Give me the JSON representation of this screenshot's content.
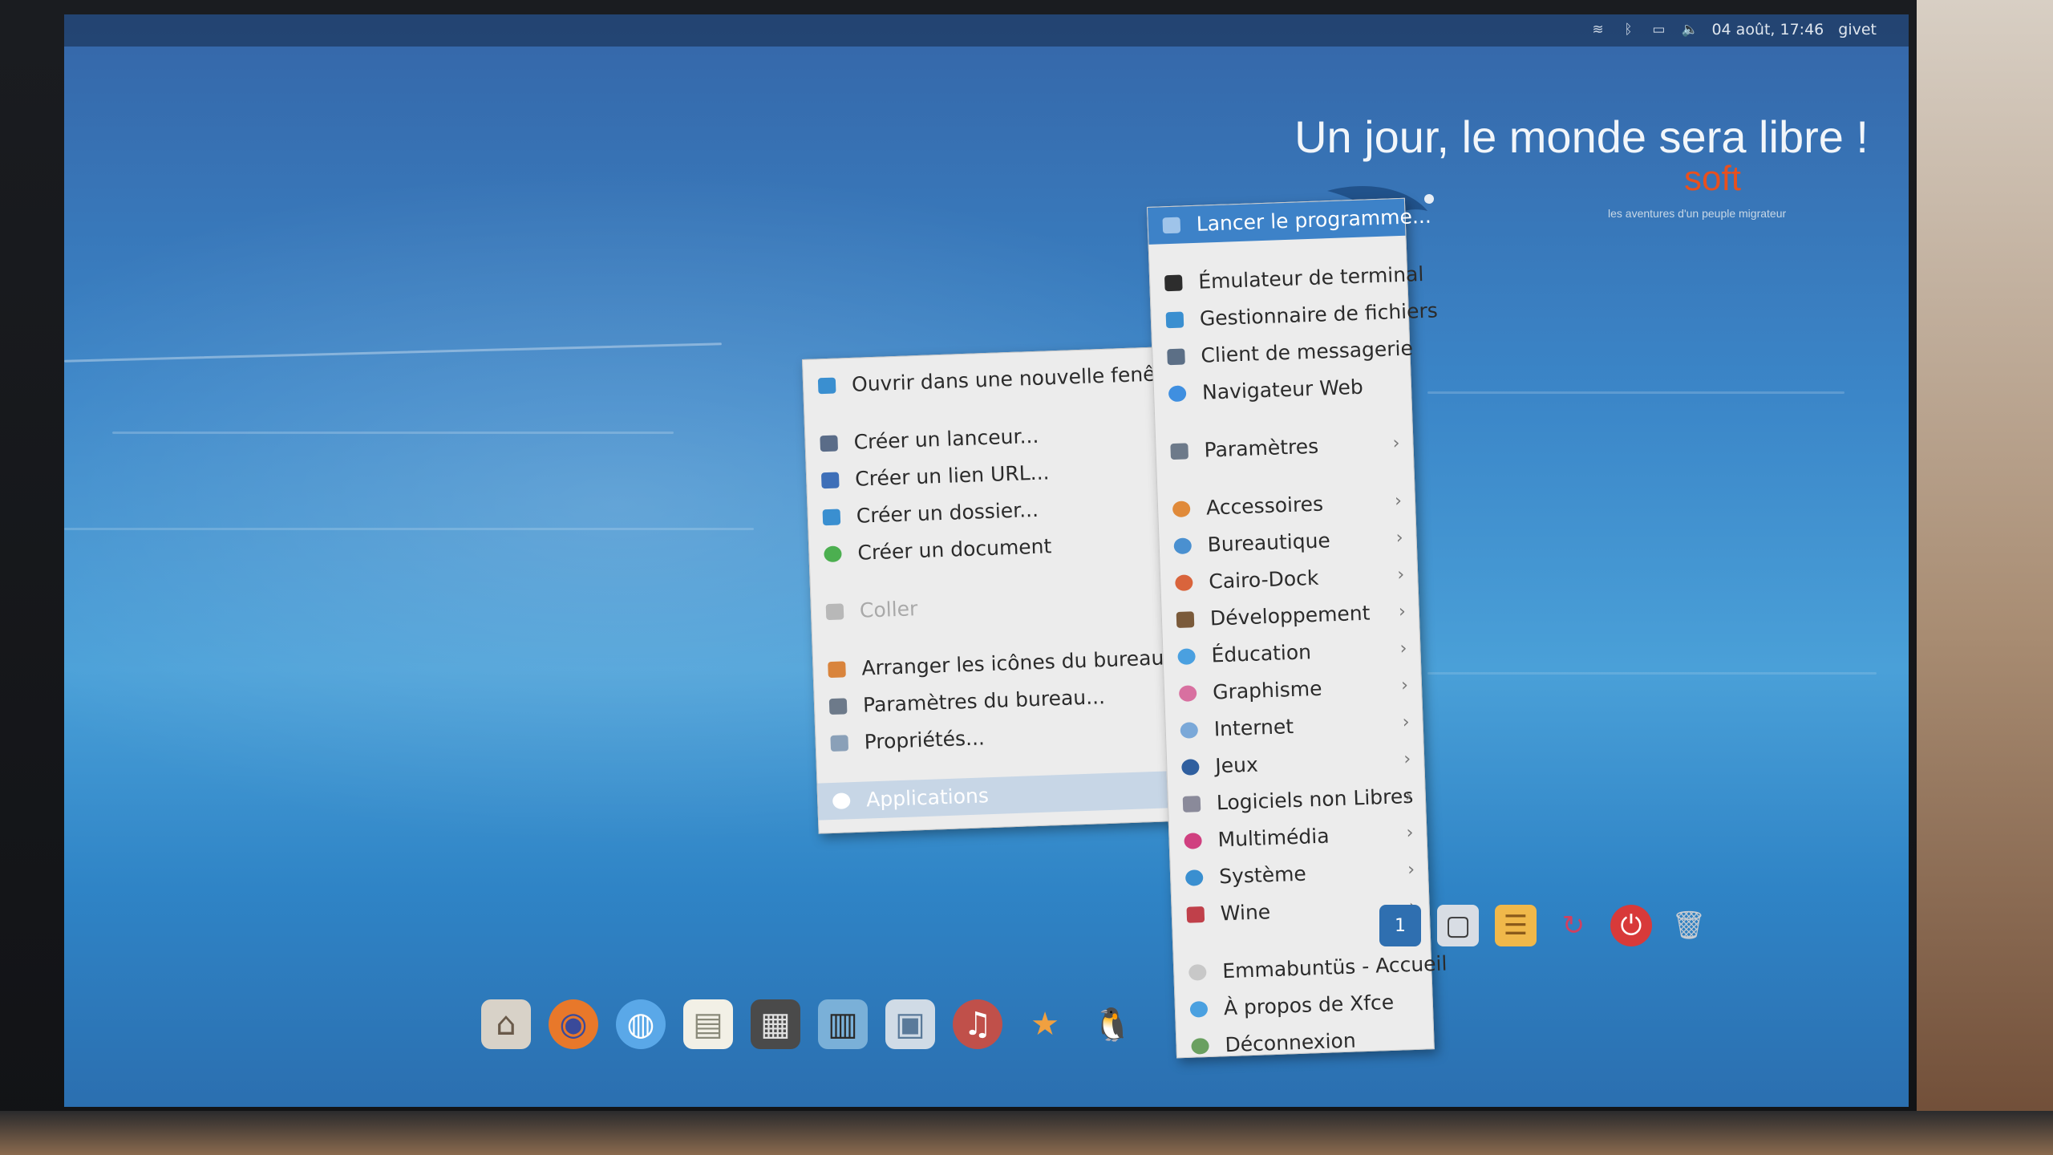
{
  "topbar": {
    "clock": "04 août, 17:46",
    "user": "givet",
    "icons": [
      "wifi-icon",
      "bluetooth-icon",
      "battery-icon",
      "volume-icon"
    ]
  },
  "wallpaper": {
    "slogan": "Un jour, le monde sera libre !",
    "brand": "soft",
    "tagline": "les aventures d'un peuple migrateur"
  },
  "desktop_menu": {
    "items": [
      {
        "label": "Ouvrir dans une nouvelle fenêtre",
        "icon": "folder-icon"
      },
      {
        "label": "Créer un lanceur...",
        "icon": "launcher-icon"
      },
      {
        "label": "Créer un lien URL...",
        "icon": "link-icon"
      },
      {
        "label": "Créer un dossier...",
        "icon": "folder-icon"
      },
      {
        "label": "Créer un document",
        "icon": "document-plus-icon"
      },
      {
        "label": "Coller",
        "icon": "paste-icon",
        "disabled": true
      },
      {
        "label": "Arranger les icônes du bureau",
        "icon": "sort-icon"
      },
      {
        "label": "Paramètres du bureau...",
        "icon": "settings-icon"
      },
      {
        "label": "Propriétés...",
        "icon": "info-icon"
      },
      {
        "label": "Applications",
        "icon": "applications-icon",
        "selected": true
      }
    ]
  },
  "app_menu": {
    "items": [
      {
        "label": "Lancer le programme...",
        "icon": "run-icon",
        "highlighted": true
      },
      {
        "label": "Émulateur de terminal",
        "icon": "terminal-icon"
      },
      {
        "label": "Gestionnaire de fichiers",
        "icon": "file-manager-icon"
      },
      {
        "label": "Client de messagerie",
        "icon": "mail-icon"
      },
      {
        "label": "Navigateur Web",
        "icon": "web-browser-icon"
      },
      {
        "label": "Paramètres",
        "icon": "settings-icon",
        "submenu": true
      },
      {
        "label": "Accessoires",
        "icon": "accessories-icon",
        "submenu": true
      },
      {
        "label": "Bureautique",
        "icon": "office-icon",
        "submenu": true
      },
      {
        "label": "Cairo-Dock",
        "icon": "cairo-dock-icon",
        "submenu": true
      },
      {
        "label": "Développement",
        "icon": "development-icon",
        "submenu": true
      },
      {
        "label": "Éducation",
        "icon": "education-icon",
        "submenu": true
      },
      {
        "label": "Graphisme",
        "icon": "graphics-icon",
        "submenu": true
      },
      {
        "label": "Internet",
        "icon": "internet-icon",
        "submenu": true
      },
      {
        "label": "Jeux",
        "icon": "games-icon",
        "submenu": true
      },
      {
        "label": "Logiciels non Libres",
        "icon": "nonfree-icon",
        "submenu": true
      },
      {
        "label": "Multimédia",
        "icon": "multimedia-icon",
        "submenu": true
      },
      {
        "label": "Système",
        "icon": "system-icon",
        "submenu": true
      },
      {
        "label": "Wine",
        "icon": "wine-icon",
        "submenu": true
      },
      {
        "label": "Emmabuntüs - Accueil",
        "icon": "home-icon"
      },
      {
        "label": "À propos de Xfce",
        "icon": "about-icon"
      },
      {
        "label": "Déconnexion",
        "icon": "logout-icon"
      }
    ]
  },
  "dock": {
    "items": [
      "home-folder-icon",
      "firefox-icon",
      "globe-icon",
      "notes-icon",
      "video-editor-icon",
      "clapper-icon",
      "photos-icon",
      "music-icon",
      "favorites-star-icon",
      "tux-icon"
    ]
  },
  "dock_right": {
    "workspace_number": "1",
    "items": [
      "workspace-switcher-icon",
      "window-icon",
      "notes-icon",
      "refresh-icon",
      "power-icon",
      "trash-icon"
    ]
  }
}
